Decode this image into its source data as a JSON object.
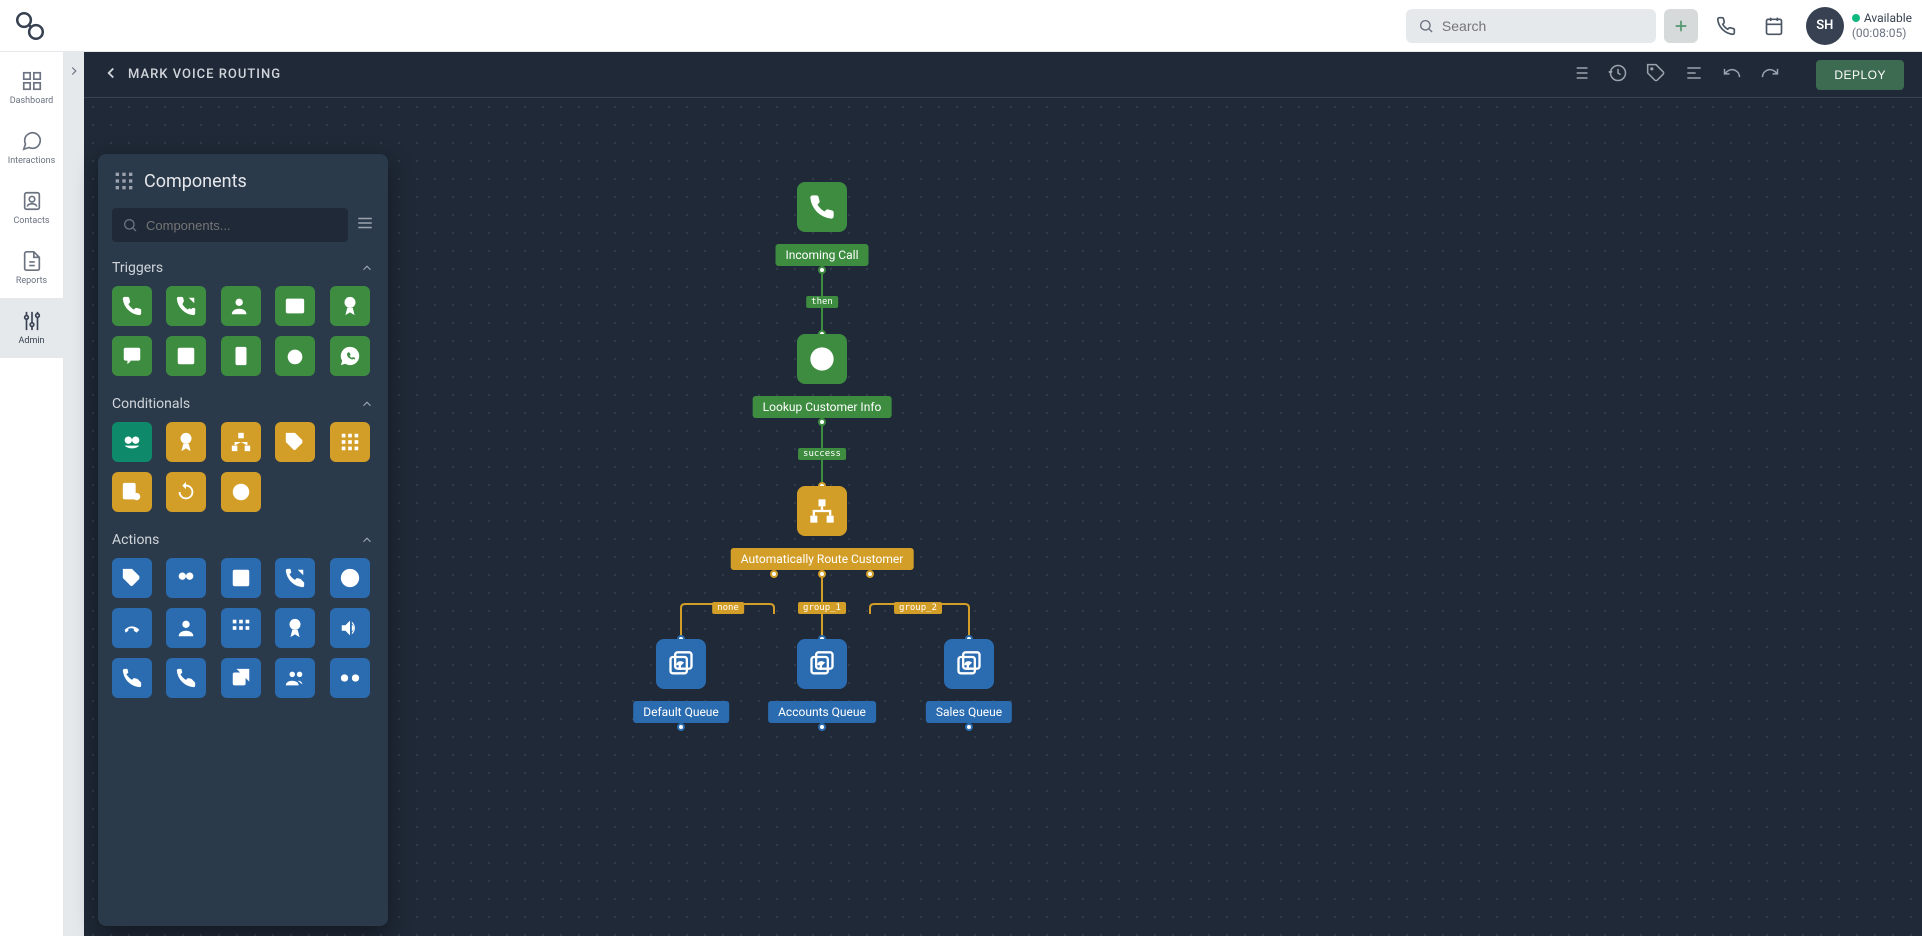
{
  "topbar": {
    "search_placeholder": "Search",
    "avatar_initials": "SH",
    "status_text": "Available",
    "timer": "(00:08:05)"
  },
  "rail": {
    "items": [
      {
        "label": "Dashboard"
      },
      {
        "label": "Interactions"
      },
      {
        "label": "Contacts"
      },
      {
        "label": "Reports"
      },
      {
        "label": "Admin"
      }
    ]
  },
  "canvas": {
    "title": "MARK VOICE ROUTING",
    "deploy_label": "DEPLOY"
  },
  "panel": {
    "title": "Components",
    "search_placeholder": "Components...",
    "sections": {
      "triggers": "Triggers",
      "conditionals": "Conditionals",
      "actions": "Actions"
    }
  },
  "flow": {
    "incoming": "Incoming Call",
    "lookup": "Lookup Customer Info",
    "route": "Automatically Route Customer",
    "default_queue": "Default Queue",
    "accounts_queue": "Accounts Queue",
    "sales_queue": "Sales Queue",
    "edges": {
      "then": "then",
      "success": "success",
      "none": "none",
      "group1": "group_1",
      "group2": "group_2"
    }
  }
}
